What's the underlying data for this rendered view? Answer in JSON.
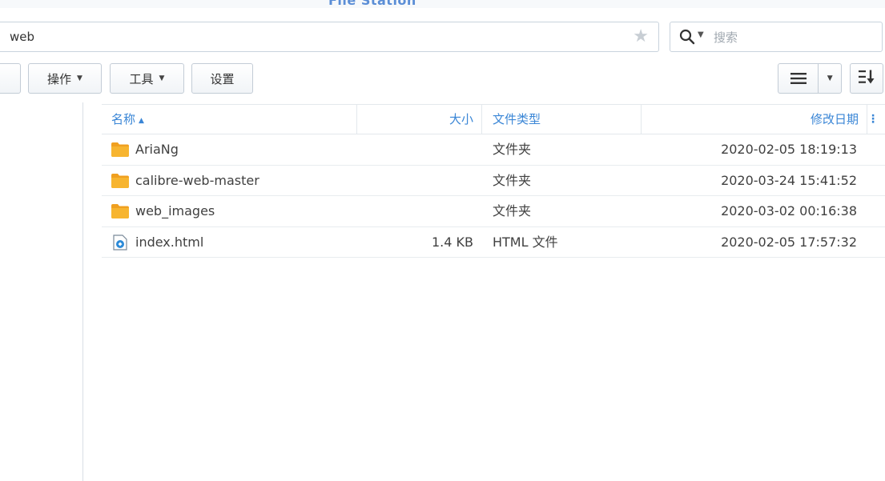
{
  "window": {
    "title": "File Station"
  },
  "path_bar": {
    "path": "web"
  },
  "search": {
    "placeholder": "搜索",
    "icon": "search-icon"
  },
  "toolbar": {
    "action_label": "操作",
    "tools_label": "工具",
    "settings_label": "设置",
    "view_icon": "list-view-icon",
    "sort_icon": "sort-icon"
  },
  "table": {
    "columns": {
      "name": "名称",
      "size": "大小",
      "type": "文件类型",
      "modified": "修改日期"
    },
    "rows": [
      {
        "name": "AriaNg",
        "size": "",
        "type": "文件夹",
        "modified": "2020-02-05 18:19:13",
        "icon": "folder-icon"
      },
      {
        "name": "calibre-web-master",
        "size": "",
        "type": "文件夹",
        "modified": "2020-03-24 15:41:52",
        "icon": "folder-icon"
      },
      {
        "name": "web_images",
        "size": "",
        "type": "文件夹",
        "modified": "2020-03-02 00:16:38",
        "icon": "folder-icon"
      },
      {
        "name": "index.html",
        "size": "1.4 KB",
        "type": "HTML 文件",
        "modified": "2020-02-05 17:57:32",
        "icon": "html-file-icon"
      }
    ]
  },
  "colors": {
    "accent": "#3a86d6",
    "folder": "#f5a623",
    "border": "#c9d3dd"
  }
}
